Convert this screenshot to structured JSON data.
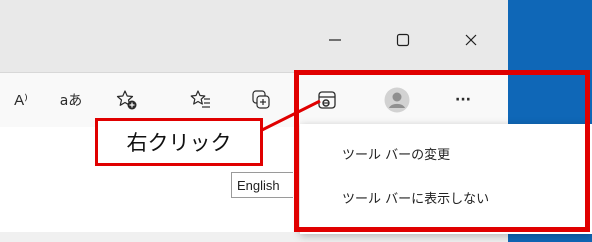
{
  "window_controls": {
    "minimize": "—",
    "maximize": "☐",
    "close": "✕"
  },
  "toolbar": {
    "read_aloud": "A⁾",
    "translate": "aあ",
    "more": "···",
    "icons": [
      "read-aloud-icon",
      "translate-icon",
      "add-favorite-icon",
      "favorites-icon",
      "collections-icon",
      "extension-button-icon",
      "profile-icon",
      "more-icon"
    ]
  },
  "page": {
    "language_select": "English"
  },
  "context_menu": {
    "items": [
      "ツール バーの変更",
      "ツール バーに表示しない"
    ]
  },
  "annotation": {
    "label": "右クリック",
    "color": "#e00000"
  },
  "colors": {
    "titlebar": "#e9e9e9",
    "toolbar": "#f9f9f9",
    "desktop": "#0f67b7"
  }
}
